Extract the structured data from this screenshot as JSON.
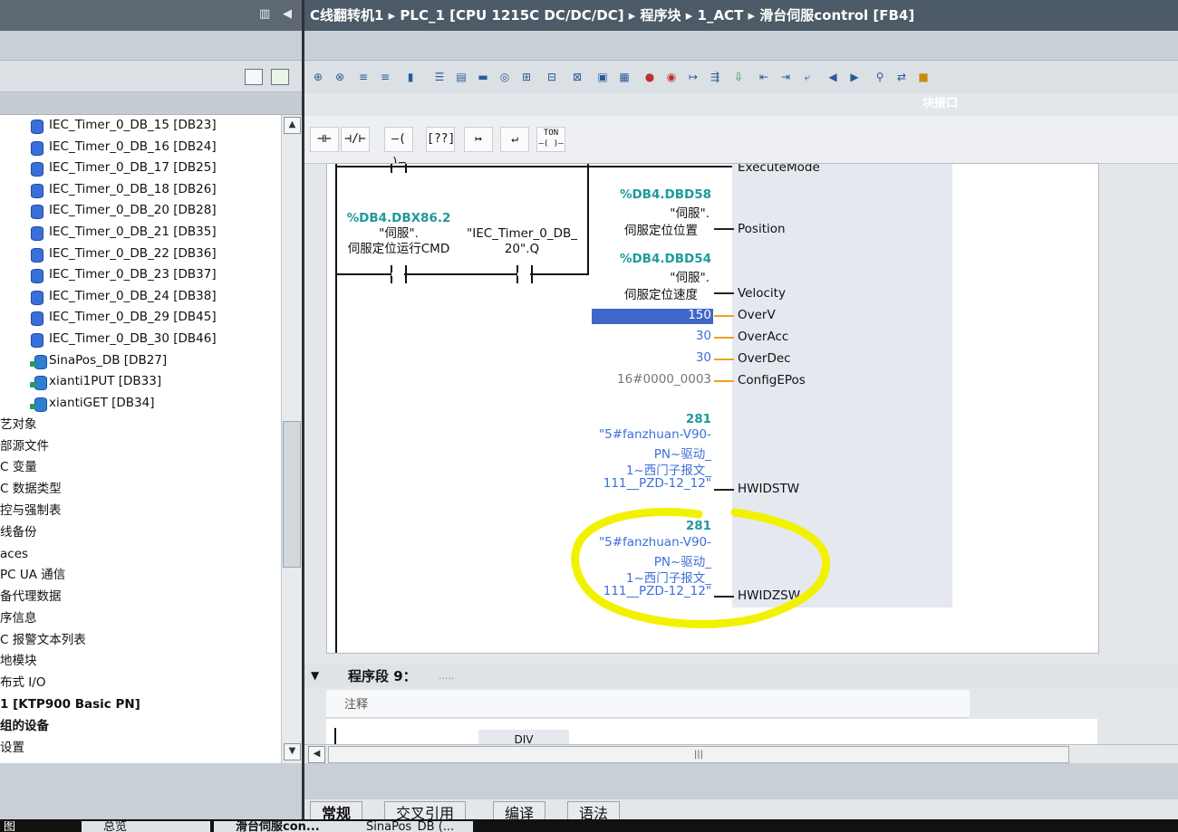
{
  "breadcrumb": "C线翻转机1 ▸ PLC_1 [CPU 1215C DC/DC/DC] ▸ 程序块 ▸ 1_ACT ▸ 滑台伺服control [FB4]",
  "block_interface": "块接口",
  "tree": {
    "db_items": [
      "IEC_Timer_0_DB_15 [DB23]",
      "IEC_Timer_0_DB_16 [DB24]",
      "IEC_Timer_0_DB_17 [DB25]",
      "IEC_Timer_0_DB_18 [DB26]",
      "IEC_Timer_0_DB_20 [DB28]",
      "IEC_Timer_0_DB_21 [DB35]",
      "IEC_Timer_0_DB_22 [DB36]",
      "IEC_Timer_0_DB_23 [DB37]",
      "IEC_Timer_0_DB_24 [DB38]",
      "IEC_Timer_0_DB_29 [DB45]",
      "IEC_Timer_0_DB_30 [DB46]"
    ],
    "db2_items": [
      "SinaPos_DB [DB27]",
      "xianti1PUT [DB33]",
      "xiantiGET [DB34]"
    ],
    "folders": [
      "艺对象",
      "部源文件",
      "C 变量",
      "C 数据类型",
      "控与强制表",
      "线备份",
      "aces",
      "PC UA 通信",
      "备代理数据",
      "序信息",
      "C 报警文本列表",
      "地模块",
      "布式 I/O"
    ],
    "devices": [
      "1 [KTP900 Basic PN]",
      "组的设备",
      "设置"
    ]
  },
  "ladder_toolbar": [
    "⊣⊢",
    "⊣/⊢",
    "–( )–",
    "[??]",
    "↦",
    "↵"
  ],
  "ton_label": "TON",
  "network8": {
    "contact1": {
      "address": "%DB4.DBX86.2",
      "line1": "\"伺服\".",
      "line2": "伺服定位运行CMD"
    },
    "contact2": {
      "line1": "\"IEC_Timer_0_DB_",
      "line2": "20\".Q"
    },
    "pins": [
      {
        "name": "ExecuteMode"
      },
      {
        "name": "Position",
        "address": "%DB4.DBD58",
        "l1": "\"伺服\".",
        "l2": "伺服定位位置"
      },
      {
        "name": "Velocity",
        "address": "%DB4.DBD54",
        "l1": "\"伺服\".",
        "l2": "伺服定位速度"
      },
      {
        "name": "OverV",
        "value": "150"
      },
      {
        "name": "OverAcc",
        "value": "30"
      },
      {
        "name": "OverDec",
        "value": "30"
      },
      {
        "name": "ConfigEPos",
        "value": "16#0000_0003"
      },
      {
        "name": "HWIDSTW",
        "const": "281",
        "l1": "\"5#fanzhuan-V90-",
        "l2": "PN~驱动_",
        "l3": "1~西门子报文_",
        "l4": "111__PZD-12_12\""
      },
      {
        "name": "HWIDZSW",
        "const": "281",
        "l1": "\"5#fanzhuan-V90-",
        "l2": "PN~驱动_",
        "l3": "1~西门子报文_",
        "l4": "111__PZD-12_12\""
      }
    ]
  },
  "network9": {
    "title": "程序段 9：",
    "dots": ".....",
    "comment": "注释",
    "div": "DIV"
  },
  "bottom_tabs": [
    "常规",
    "交叉引用",
    "编译",
    "语法"
  ],
  "taskbar": [
    "图",
    "总览",
    "滑台伺服con...",
    "SinaPos_DB (..."
  ],
  "highlight_color": "#f2f200"
}
